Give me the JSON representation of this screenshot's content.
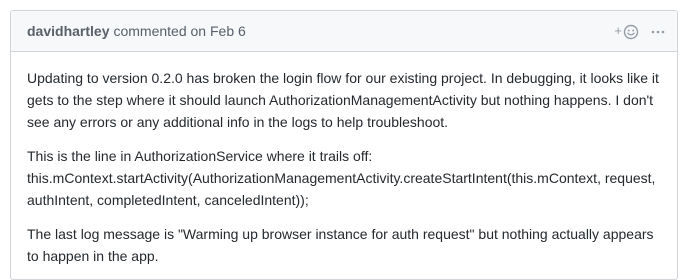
{
  "comment": {
    "author": "davidhartley",
    "meta": "commented on Feb 6",
    "reaction_plus": "+",
    "paragraphs": [
      "Updating to version 0.2.0 has broken the login flow for our existing project. In debugging, it looks like it gets to the step where it should launch AuthorizationManagementActivity but nothing happens. I don't see any errors or any additional info in the logs to help troubleshoot.",
      "This is the line in AuthorizationService where it trails off:",
      "this.mContext.startActivity(AuthorizationManagementActivity.createStartIntent(this.mContext, request, authIntent, completedIntent, canceledIntent));",
      "The last log message is \"Warming up browser instance for auth request\" but nothing actually appears to happen in the app."
    ]
  },
  "icons": {
    "reaction": "smiley-icon",
    "more": "kebab-horizontal-icon"
  },
  "colors": {
    "header_bg": "#f6f8fa",
    "border": "#d1d5da",
    "muted_text": "#586069",
    "icon": "#959da5",
    "body_text": "#24292e"
  }
}
